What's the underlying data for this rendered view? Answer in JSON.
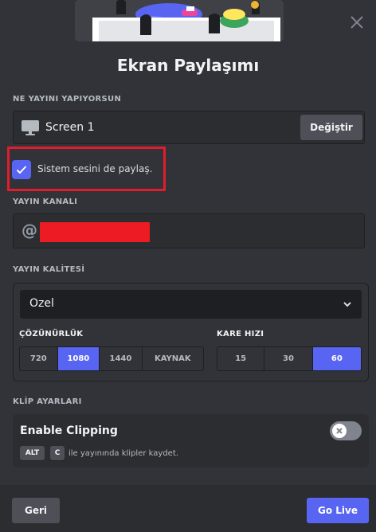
{
  "modal": {
    "title": "Ekran Paylaşımı"
  },
  "source": {
    "section_label": "NE YAYINI YAPIYORSUN",
    "screen_name": "Screen 1",
    "change_label": "Değiştir",
    "screen_icon": "monitor-icon"
  },
  "audio": {
    "checkbox_label": "Sistem sesini de paylaş.",
    "checked": true
  },
  "channel": {
    "section_label": "YAYIN KANALI",
    "at_symbol": "@"
  },
  "quality": {
    "section_label": "YAYIN KALİTESİ",
    "preset": "Ozel",
    "resolution_label": "ÇÖZÜNÜRLÜK",
    "resolution_options": [
      "720",
      "1080",
      "1440",
      "KAYNAK"
    ],
    "resolution_selected": "1080",
    "framerate_label": "KARE HIZI",
    "framerate_options": [
      "15",
      "30",
      "60"
    ],
    "framerate_selected": "60"
  },
  "clips": {
    "section_label": "KLİP AYARLARI",
    "title": "Enable Clipping",
    "enabled": false,
    "key1": "ALT",
    "key2": "C",
    "description": "ile yayınında klipler kaydet."
  },
  "footer": {
    "back_label": "Geri",
    "go_live_label": "Go Live"
  },
  "colors": {
    "accent": "#5865f2",
    "highlight": "#e01d2d",
    "redaction": "#ed1c24",
    "background": "#313338"
  }
}
